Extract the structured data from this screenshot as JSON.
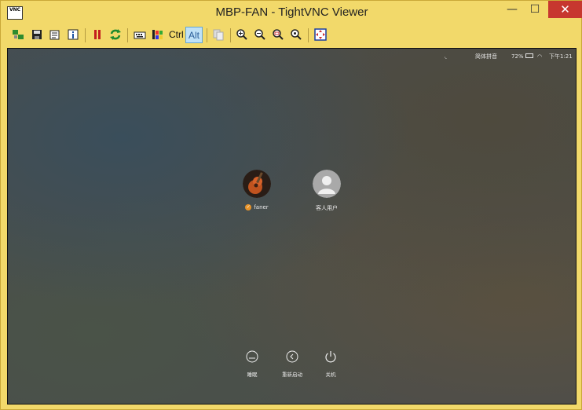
{
  "window": {
    "title": "MBP-FAN - TightVNC Viewer",
    "app_icon_text": "VNC",
    "minimize_glyph": "—",
    "maximize_glyph": "☐",
    "close_glyph": "✕"
  },
  "toolbar": {
    "ctrl_label": "Ctrl",
    "alt_label": "Alt"
  },
  "menubar": {
    "input_method": "简体拼音",
    "battery": "72%",
    "clock": "下午1:21"
  },
  "users": [
    {
      "name": "faner"
    },
    {
      "name": "客人用户"
    }
  ],
  "actions": [
    {
      "label": "睡眠"
    },
    {
      "label": "重新启动"
    },
    {
      "label": "关机"
    }
  ]
}
